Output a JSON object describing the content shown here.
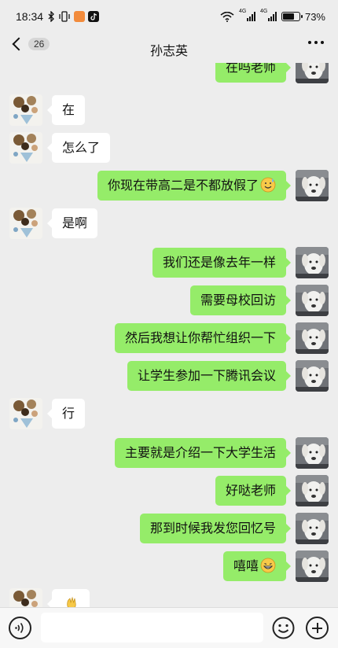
{
  "status_bar": {
    "time": "18:34",
    "network_a": "4G",
    "network_b": "4G",
    "battery_percent": "73%",
    "battery_level": 0.73,
    "icons": [
      "bluetooth-icon",
      "vibrate-icon",
      "app-notification-icon",
      "tiktok-icon",
      "wifi-icon",
      "signal-icon",
      "battery-icon"
    ]
  },
  "nav": {
    "back_count": "26",
    "title": "孙志英",
    "more_icon": "more-dots-icon"
  },
  "messages": [
    {
      "side": "out",
      "text": "在吗老师",
      "emoji": null
    },
    {
      "side": "in",
      "text": "在",
      "emoji": null
    },
    {
      "side": "in",
      "text": "怎么了",
      "emoji": null
    },
    {
      "side": "out",
      "text": "你现在带高二是不都放假了",
      "emoji": "sweat-smile-emoji"
    },
    {
      "side": "in",
      "text": "是啊",
      "emoji": null
    },
    {
      "side": "out",
      "text": "我们还是像去年一样",
      "emoji": null
    },
    {
      "side": "out",
      "text": "需要母校回访",
      "emoji": null
    },
    {
      "side": "out",
      "text": "然后我想让你帮忙组织一下",
      "emoji": null
    },
    {
      "side": "out",
      "text": "让学生参加一下腾讯会议",
      "emoji": null
    },
    {
      "side": "in",
      "text": "行",
      "emoji": null
    },
    {
      "side": "out",
      "text": "主要就是介绍一下大学生活",
      "emoji": null
    },
    {
      "side": "out",
      "text": "好哒老师",
      "emoji": null
    },
    {
      "side": "out",
      "text": "那到时候我发您回忆号",
      "emoji": null
    },
    {
      "side": "out",
      "text": "嘻嘻",
      "emoji": "grin-emoji"
    },
    {
      "side": "in",
      "text": "",
      "emoji": "waving-hand-emoji"
    }
  ],
  "input_bar": {
    "placeholder": "",
    "voice_icon": "voice-icon",
    "emoji_icon": "emoji-icon",
    "plus_icon": "plus-icon"
  },
  "colors": {
    "background": "#ededed",
    "bubble_out": "#95ec69",
    "bubble_in": "#ffffff"
  }
}
